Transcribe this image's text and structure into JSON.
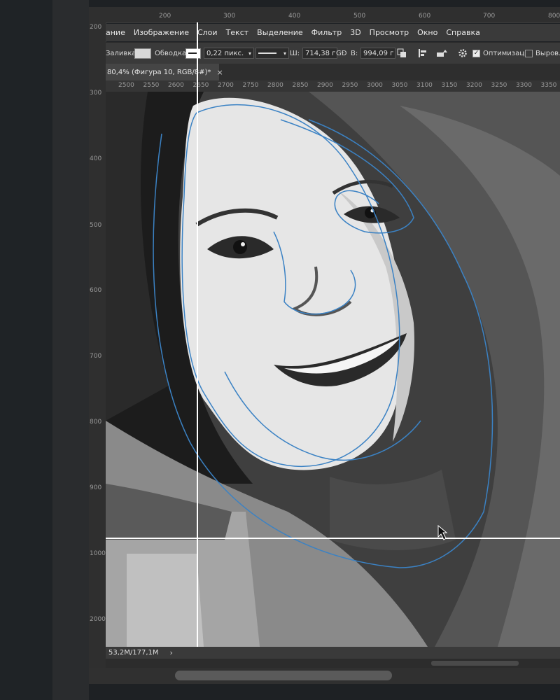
{
  "menu": [
    "ание",
    "Изображение",
    "Слои",
    "Текст",
    "Выделение",
    "Фильтр",
    "3D",
    "Просмотр",
    "Окно",
    "Справка"
  ],
  "options": {
    "fill_label": "Заливка:",
    "stroke_label": "Обводка:",
    "stroke_size": "0,22 пикс.",
    "width_label": "Ш:",
    "width_value": "714,38 г",
    "link_symbol": "GÐ",
    "height_label": "В:",
    "height_value": "994,09 г",
    "optimize_label": "Оптимизация",
    "align_edges_label": "Выров. к"
  },
  "document_tab": {
    "title": "80,4% (Фигура 10, RGB/8#)*",
    "close": "×"
  },
  "outer_ruler_top": [
    "200",
    "300",
    "400",
    "500",
    "600",
    "700",
    "800"
  ],
  "outer_ruler_left": [
    "200",
    "300",
    "400",
    "500",
    "600",
    "700",
    "800",
    "900",
    "1000",
    "2000"
  ],
  "doc_ruler_top": [
    "2500",
    "2550",
    "2600",
    "2650",
    "2700",
    "2750",
    "2800",
    "2850",
    "2900",
    "2950",
    "3000",
    "3050",
    "3100",
    "3150",
    "3200",
    "3250",
    "3300",
    "3350"
  ],
  "status": {
    "doc_size": "53,2M/177,1M",
    "arrow": "›"
  },
  "colors": {
    "accent_pink": "#f06474",
    "path_blue": "#3b82c4"
  }
}
